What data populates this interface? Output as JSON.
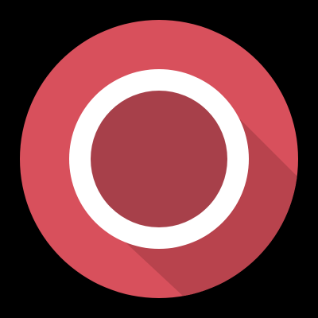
{
  "icon": {
    "name": "record-icon",
    "colors": {
      "background": "#000000",
      "disc": "#D8505C",
      "disc_highlight": "#E05A66",
      "long_shadow": "#B8434D",
      "inner_fill": "#A7404A",
      "ring": "#FFFFFF"
    }
  }
}
